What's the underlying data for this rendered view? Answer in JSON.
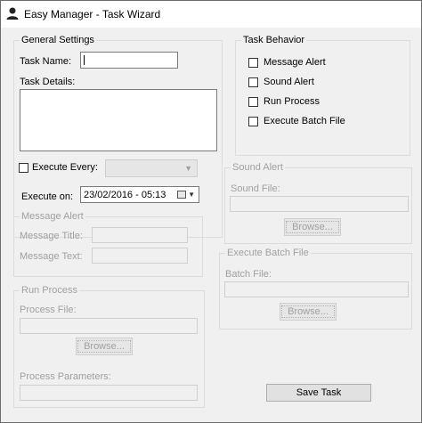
{
  "window": {
    "title": "Easy Manager - Task Wizard"
  },
  "general": {
    "legend": "General Settings",
    "task_name_label": "Task Name:",
    "task_name_value": "",
    "task_details_label": "Task Details:",
    "task_details_value": "",
    "execute_every_label": "Execute Every:",
    "execute_every_checked": false,
    "execute_every_value": "",
    "execute_on_label": "Execute on:",
    "execute_on_value": "23/02/2016 - 05:13"
  },
  "behavior": {
    "legend": "Task Behavior",
    "items": [
      {
        "label": "Message Alert",
        "checked": false
      },
      {
        "label": "Sound Alert",
        "checked": false
      },
      {
        "label": "Run Process",
        "checked": false
      },
      {
        "label": "Execute Batch File",
        "checked": false
      }
    ]
  },
  "sound_alert": {
    "legend": "Sound Alert",
    "file_label": "Sound File:",
    "browse_label": "Browse..."
  },
  "message_alert": {
    "legend": "Message Alert",
    "title_label": "Message Title:",
    "text_label": "Message Text:"
  },
  "batch_file": {
    "legend": "Execute Batch File",
    "file_label": "Batch File:",
    "browse_label": "Browse..."
  },
  "run_process": {
    "legend": "Run Process",
    "file_label": "Process File:",
    "browse_label": "Browse...",
    "params_label": "Process Parameters:"
  },
  "actions": {
    "save_label": "Save Task"
  }
}
